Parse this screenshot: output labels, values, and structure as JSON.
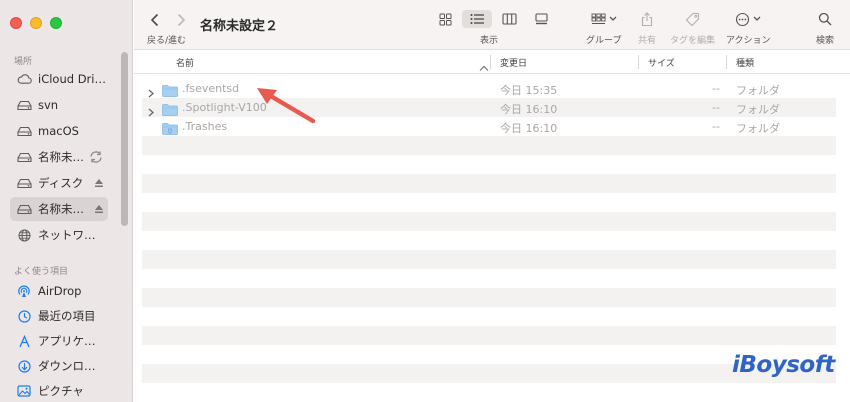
{
  "window": {
    "title": "名称未設定２"
  },
  "toolbar": {
    "nav_label": "戻る/進む",
    "view_label": "表示",
    "group_label": "グループ",
    "share_label": "共有",
    "tag_label": "タグを編集",
    "action_label": "アクション",
    "search_label": "検索"
  },
  "sidebar": {
    "section_places": "場所",
    "section_favorites": "よく使う項目",
    "places": [
      {
        "label": "iCloud Dri…",
        "icon": "cloud-icon"
      },
      {
        "label": "svn",
        "icon": "drive-icon"
      },
      {
        "label": "macOS",
        "icon": "drive-icon"
      },
      {
        "label": "名称未…",
        "icon": "drive-icon",
        "trailing": "sync-icon"
      },
      {
        "label": "ディスク",
        "icon": "drive-icon",
        "trailing": "eject-icon"
      },
      {
        "label": "名称未…",
        "icon": "drive-icon",
        "trailing": "eject-icon",
        "selected": true
      },
      {
        "label": "ネットワ…",
        "icon": "globe-icon"
      }
    ],
    "favorites": [
      {
        "label": "AirDrop",
        "icon": "airdrop-icon"
      },
      {
        "label": "最近の項目",
        "icon": "clock-icon"
      },
      {
        "label": "アプリケ…",
        "icon": "apps-icon"
      },
      {
        "label": "ダウンロ…",
        "icon": "download-icon"
      },
      {
        "label": "ピクチャ",
        "icon": "photo-icon"
      }
    ]
  },
  "columns": {
    "name": "名前",
    "modified": "変更日",
    "size": "サイズ",
    "kind": "種類"
  },
  "files": [
    {
      "name": ".fseventsd",
      "modified": "今日 15:35",
      "size": "--",
      "kind": "フォルダ"
    },
    {
      "name": ".Spotlight-V100",
      "modified": "今日 16:10",
      "size": "--",
      "kind": "フォルダ"
    },
    {
      "name": ".Trashes",
      "modified": "今日 16:10",
      "size": "--",
      "kind": "フォルダ"
    }
  ],
  "watermark": "iBoysoft",
  "colors": {
    "accent": "#1c7df2",
    "arrow": "#e85a4f",
    "watermark": "#2f63c6"
  }
}
